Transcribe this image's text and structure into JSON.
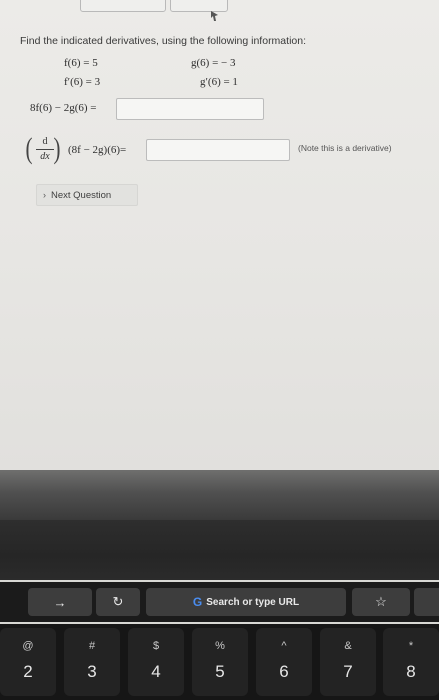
{
  "instructions": "Find the indicated derivatives, using the following information:",
  "given": {
    "f6": "f(6) = 5",
    "g6": "g(6) = − 3",
    "fp6": "f′(6) = 3",
    "gp6": "g′(6) = 1"
  },
  "question1": {
    "expr": "8f(6) − 2g(6) =",
    "value": ""
  },
  "question2": {
    "deriv_num": "d",
    "deriv_den": "dx",
    "expr": "(8f − 2g)(6)=",
    "value": "",
    "note": "(Note this is a derivative)"
  },
  "next_button": {
    "label": "Next Question",
    "icon": "chevron-right-icon"
  },
  "touchbar": {
    "search_label": "Search or type URL",
    "arrow_icon": "arrow-right-icon",
    "reload_icon": "reload-icon",
    "google_icon": "google-g-icon",
    "bookmark_icon": "star-icon"
  },
  "keys": [
    {
      "sym": "@",
      "num": "2"
    },
    {
      "sym": "#",
      "num": "3"
    },
    {
      "sym": "$",
      "num": "4"
    },
    {
      "sym": "%",
      "num": "5"
    },
    {
      "sym": "^",
      "num": "6"
    },
    {
      "sym": "&",
      "num": "7"
    },
    {
      "sym": "*",
      "num": "8"
    }
  ]
}
